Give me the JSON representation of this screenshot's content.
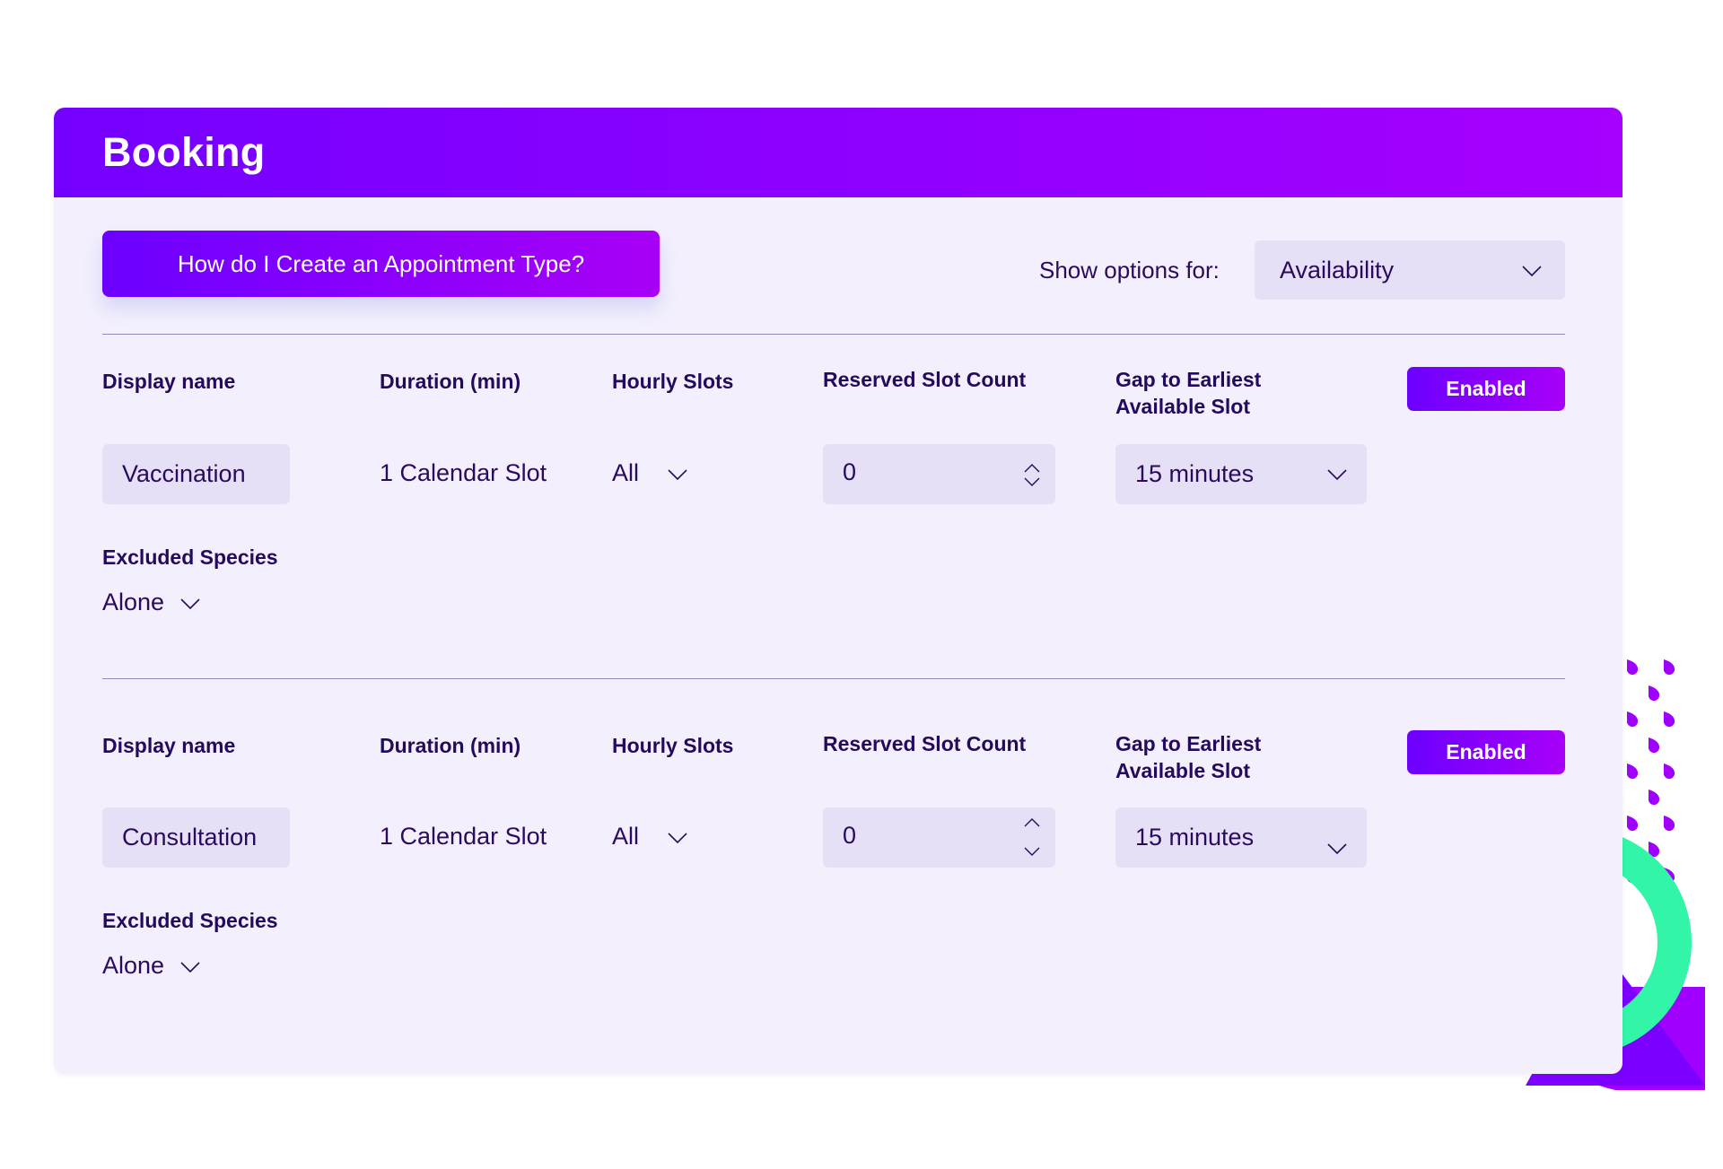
{
  "header": {
    "title": "Booking"
  },
  "toolbar": {
    "howto_label": "How do I Create an Appointment Type?",
    "show_options_label": "Show options for:",
    "show_options_value": "Availability"
  },
  "columns": {
    "display_name": "Display name",
    "duration": "Duration (min)",
    "hourly_slots": "Hourly Slots",
    "reserved_slot_count": "Reserved Slot Count",
    "gap_line1": "Gap to Earliest",
    "gap_line2": "Available Slot",
    "excluded_species": "Excluded Species"
  },
  "appointment_types": [
    {
      "display_name": "Vaccination",
      "duration": "1 Calendar Slot",
      "hourly_slots": "All",
      "reserved_slot_count": "0",
      "gap": "15 minutes",
      "status": "Enabled",
      "excluded_species": "Alone"
    },
    {
      "display_name": "Consultation",
      "duration": "1 Calendar Slot",
      "hourly_slots": "All",
      "reserved_slot_count": "0",
      "gap": "15 minutes",
      "status": "Enabled",
      "excluded_species": "Alone"
    }
  ],
  "colors": {
    "brand_purple": "#7400ff",
    "brand_magenta": "#a600ff",
    "panel_bg": "#f3effd",
    "field_bg": "#e6e0f6",
    "text_dark": "#2a0a5e",
    "accent_teal": "#33f5a8"
  }
}
